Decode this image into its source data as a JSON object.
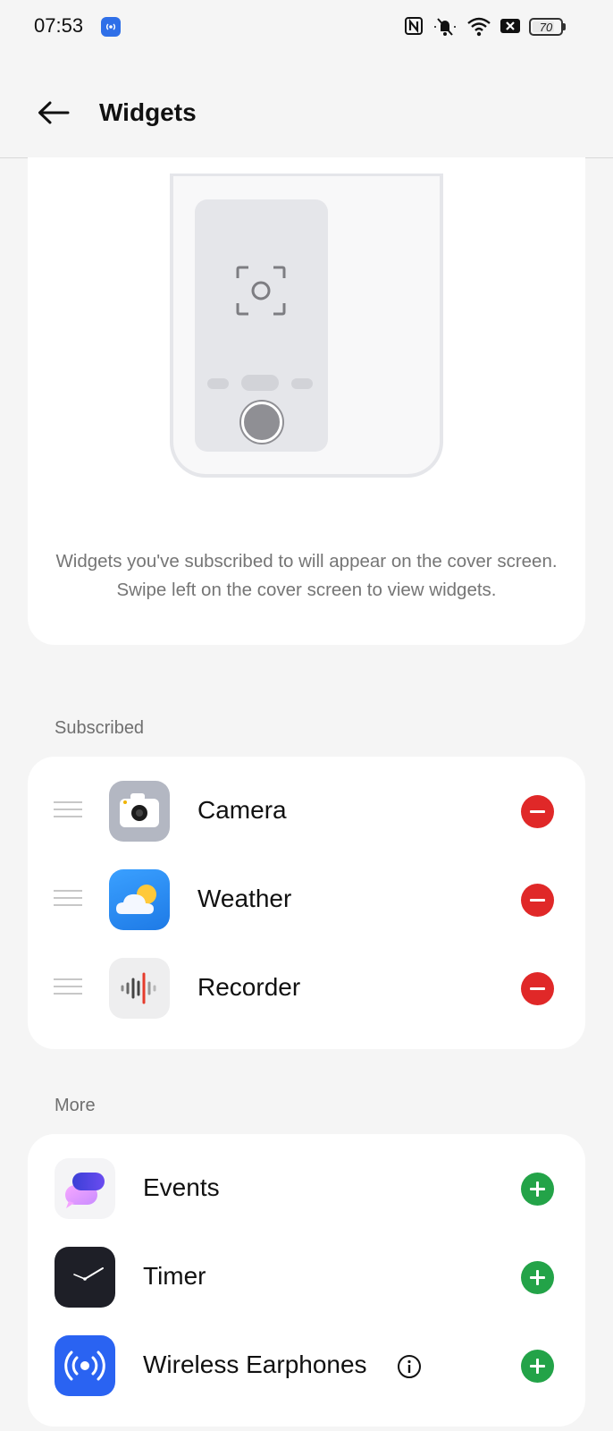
{
  "status_bar": {
    "time": "07:53",
    "battery_level": "70",
    "icons": [
      "hotspot-icon",
      "nfc-icon",
      "mute-icon",
      "wifi-icon",
      "sim-off-icon",
      "battery-icon"
    ]
  },
  "header": {
    "title": "Widgets",
    "back_icon": "arrow-left-icon"
  },
  "preview": {
    "description": "Widgets you've subscribed to will appear on the cover screen. Swipe left on the cover screen to view widgets."
  },
  "subscribed": {
    "label": "Subscribed",
    "items": [
      {
        "label": "Camera",
        "icon": "camera-icon",
        "action": "remove"
      },
      {
        "label": "Weather",
        "icon": "weather-icon",
        "action": "remove"
      },
      {
        "label": "Recorder",
        "icon": "recorder-icon",
        "action": "remove"
      }
    ]
  },
  "more": {
    "label": "More",
    "items": [
      {
        "label": "Events",
        "icon": "events-icon",
        "action": "add"
      },
      {
        "label": "Timer",
        "icon": "timer-icon",
        "action": "add"
      },
      {
        "label": "Wireless Earphones",
        "icon": "wireless-earphones-icon",
        "action": "add",
        "info_icon": "info-icon"
      }
    ]
  },
  "colors": {
    "remove": "#e02828",
    "add": "#23a348",
    "accent_blue": "#2f6fe8"
  }
}
